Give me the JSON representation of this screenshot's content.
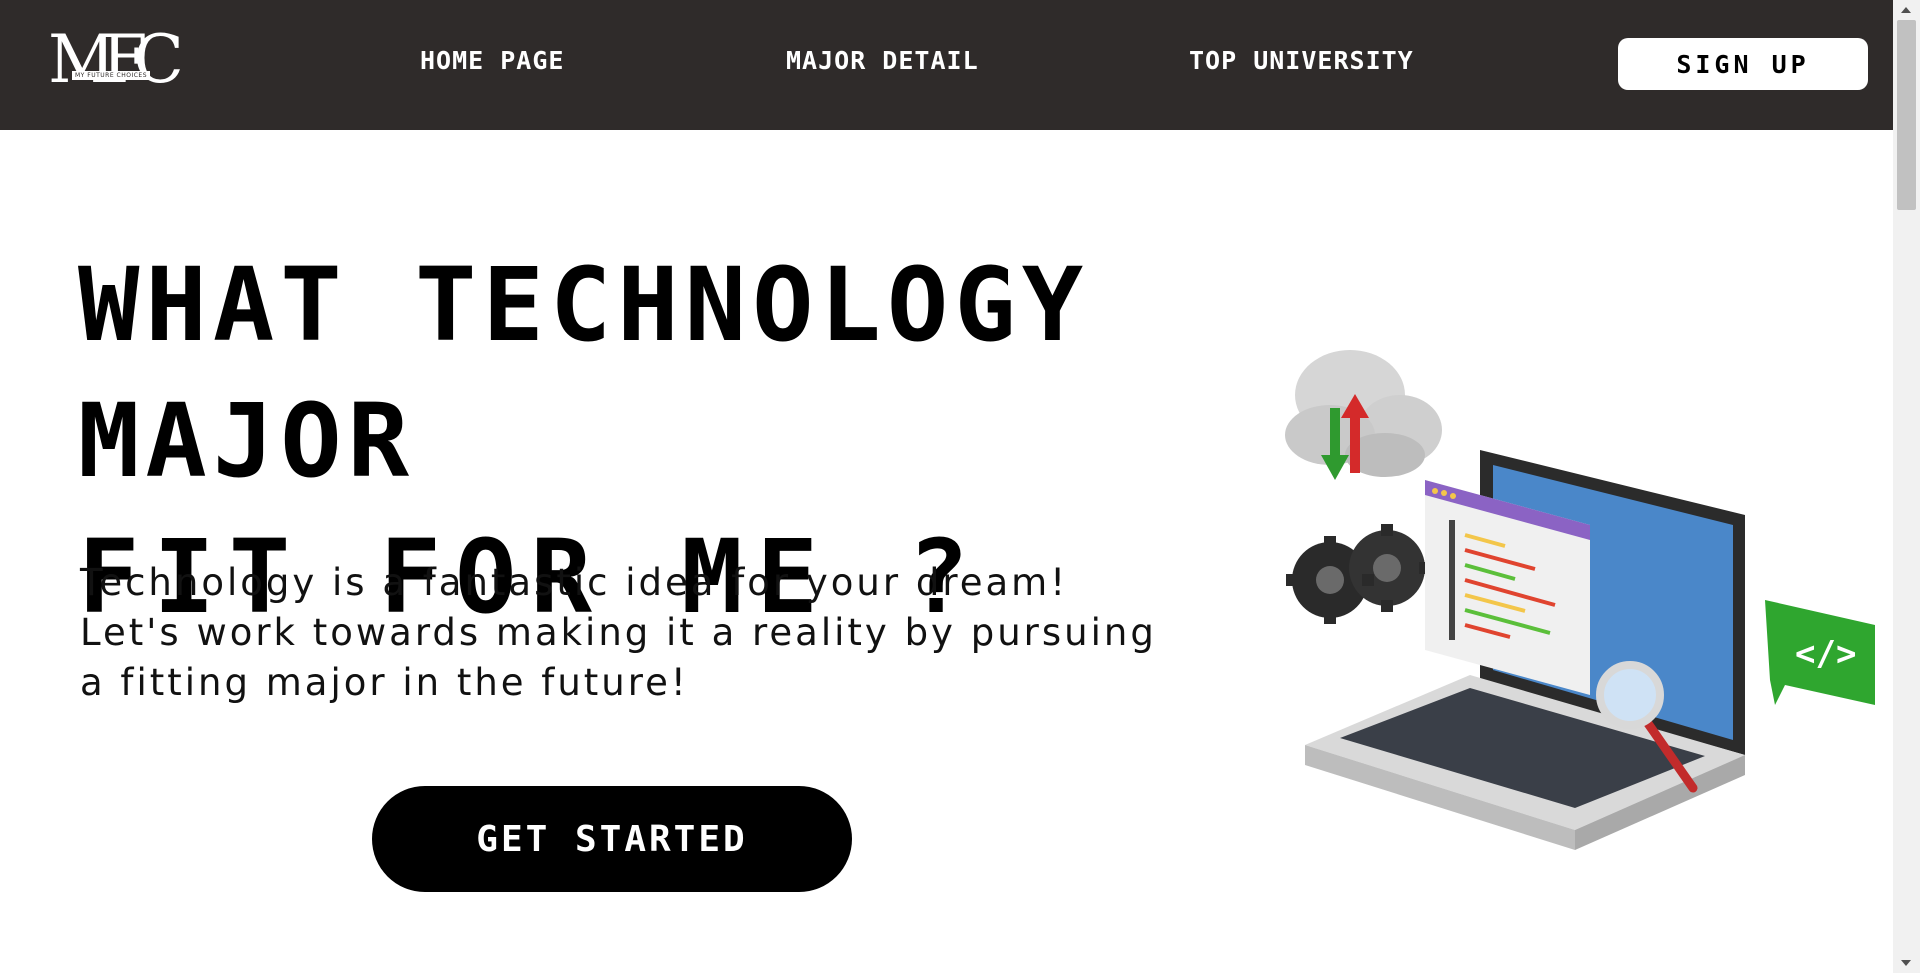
{
  "logo": {
    "letters": "MFC",
    "tagline": "MY FUTURE CHOICES"
  },
  "nav": {
    "links": [
      {
        "label": "HOME PAGE"
      },
      {
        "label": "MAJOR DETAIL"
      },
      {
        "label": "TOP UNIVERSITY"
      }
    ],
    "signup_label": "SIGN UP"
  },
  "hero": {
    "title_lines": [
      "WHAT TECHNOLOGY MAJOR",
      "FIT FOR ME ?"
    ],
    "description_lines": [
      "Technology is a fantastic idea for your dream!",
      "Let's work towards making it a reality by pursuing",
      "a fitting major in the future!"
    ],
    "cta_label": "GET STARTED",
    "illustration_icon": "laptop-coding-illustration",
    "code_symbol": "</>"
  },
  "colors": {
    "navbar": "#2f2b2a",
    "text": "#000000",
    "button": "#000000",
    "button_text": "#ffffff",
    "screen_blue": "#4a87c9",
    "window_purple": "#8b63c4",
    "chat_green": "#2fa62f",
    "arrow_red": "#d42a2a",
    "arrow_green": "#2f9a2f"
  }
}
